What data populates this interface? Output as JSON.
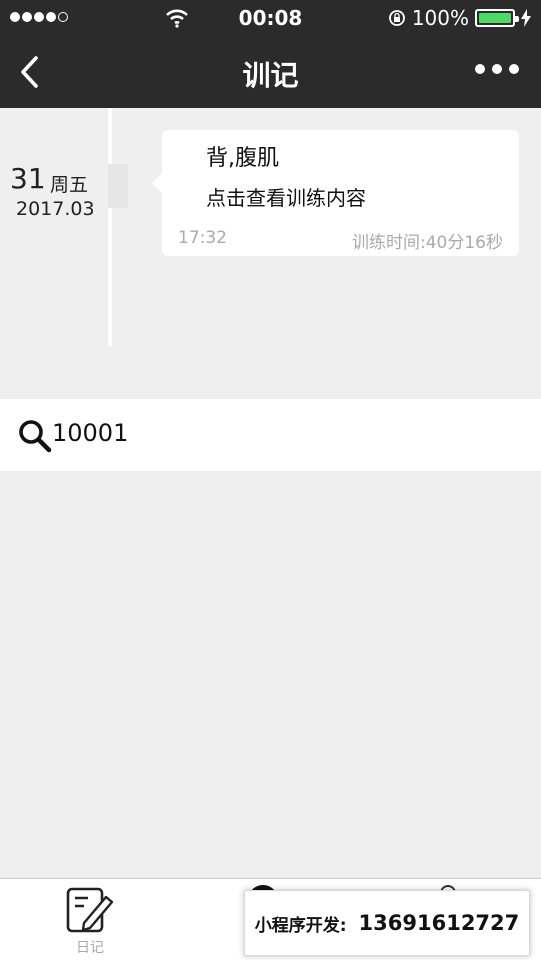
{
  "status": {
    "time": "00:08",
    "battery_text": "100%",
    "battery_level": 1.0,
    "battery_color": "#4cd964",
    "signal_filled": 4,
    "signal_total": 5
  },
  "nav": {
    "title": "训记",
    "back_icon": "chevron-left-icon",
    "more_icon": "more-dots-icon"
  },
  "timeline": {
    "entries": [
      {
        "day": "31",
        "weekday": "周五",
        "year_month": "2017.03",
        "title": "背,腹肌",
        "link": "点击查看训练内容",
        "time": "17:32",
        "duration": "训练时间:40分16秒"
      }
    ]
  },
  "search": {
    "icon": "search-icon",
    "value": "10001"
  },
  "tabbar": {
    "tabs": [
      {
        "label": "日记",
        "icon": "diary-edit-icon"
      }
    ]
  },
  "promo": {
    "label": "小程序开发:",
    "phone": "13691612727"
  },
  "colors": {
    "header_bg": "#2b2b2b",
    "page_bg": "#efefef",
    "muted_text": "#aaaaaa"
  }
}
